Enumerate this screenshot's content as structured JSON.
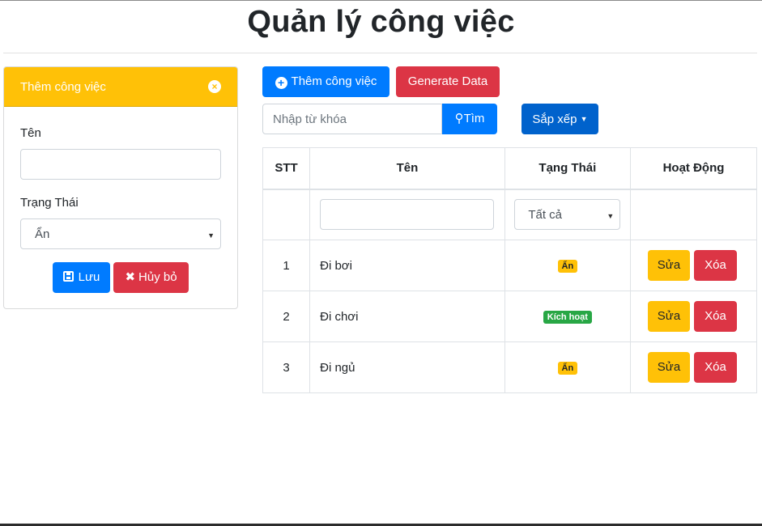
{
  "page": {
    "title": "Quản lý công việc"
  },
  "form": {
    "header": "Thêm công việc",
    "name_label": "Tên",
    "name_value": "",
    "status_label": "Trạng Thái",
    "status_value": "Ẩn",
    "save_label": "Lưu",
    "cancel_label": "Hủy bỏ"
  },
  "toolbar": {
    "add_label": "Thêm công việc",
    "generate_label": "Generate Data",
    "search_placeholder": "Nhập từ khóa",
    "search_button": "Tìm",
    "sort_label": "Sắp xếp"
  },
  "table": {
    "headers": [
      "STT",
      "Tên",
      "Tạng Thái",
      "Hoạt Động"
    ],
    "filter_status": "Tất cả",
    "rows": [
      {
        "stt": "1",
        "name": "Đi bơi",
        "status": "Ẩn",
        "status_color": "#ffc107",
        "edit": "Sửa",
        "delete": "Xóa"
      },
      {
        "stt": "2",
        "name": "Đi chơi",
        "status": "Kích hoạt",
        "status_color": "#28a745",
        "edit": "Sửa",
        "delete": "Xóa"
      },
      {
        "stt": "3",
        "name": "Đi ngủ",
        "status": "Ẩn",
        "status_color": "#ffc107",
        "edit": "Sửa",
        "delete": "Xóa"
      }
    ]
  },
  "colors": {
    "primary": "#007bff",
    "danger": "#dc3545",
    "warning": "#ffc107",
    "success": "#28a745"
  }
}
